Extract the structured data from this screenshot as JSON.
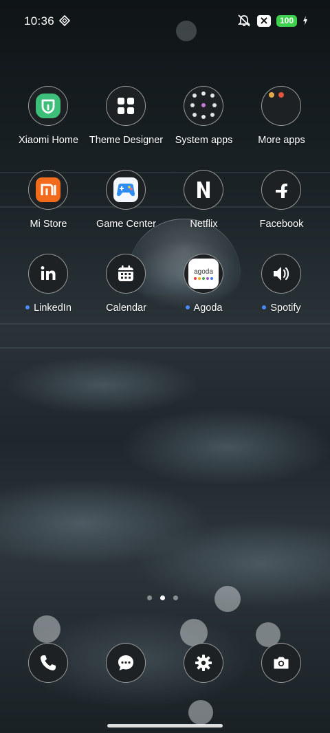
{
  "status_bar": {
    "time": "10:36",
    "battery_level": "100",
    "icons": [
      "app-notification-icon",
      "silent-icon",
      "x-icon",
      "battery-icon",
      "charging-icon"
    ]
  },
  "apps": [
    {
      "label": "Xiaomi Home",
      "icon": "xiaomi-home-icon",
      "badge_dot": false
    },
    {
      "label": "Theme Designer",
      "icon": "grid-icon",
      "badge_dot": false
    },
    {
      "label": "System apps",
      "icon": "folder-icon",
      "badge_dot": false
    },
    {
      "label": "More apps",
      "icon": "folder-icon",
      "badge_dot": false
    },
    {
      "label": "Mi Store",
      "icon": "mi-store-icon",
      "badge_dot": false
    },
    {
      "label": "Game Center",
      "icon": "gamepad-icon",
      "badge_dot": false
    },
    {
      "label": "Netflix",
      "icon": "netflix-icon",
      "badge_dot": false
    },
    {
      "label": "Facebook",
      "icon": "facebook-icon",
      "badge_dot": false
    },
    {
      "label": "LinkedIn",
      "icon": "linkedin-icon",
      "badge_dot": true
    },
    {
      "label": "Calendar",
      "icon": "calendar-icon",
      "badge_dot": false
    },
    {
      "label": "Agoda",
      "icon": "agoda-icon",
      "badge_dot": true,
      "logo_text": "agoda"
    },
    {
      "label": "Spotify",
      "icon": "speaker-icon",
      "badge_dot": true
    }
  ],
  "page_indicator": {
    "pages": 3,
    "active": 2
  },
  "dock": [
    "phone-icon",
    "messages-icon",
    "settings-icon",
    "camera-icon"
  ],
  "colors": {
    "badge_dot": "#4a8cff",
    "battery": "#3ed14d",
    "xiaomi_home": "#3dbf7a",
    "mi_store": "#f26b1d"
  }
}
